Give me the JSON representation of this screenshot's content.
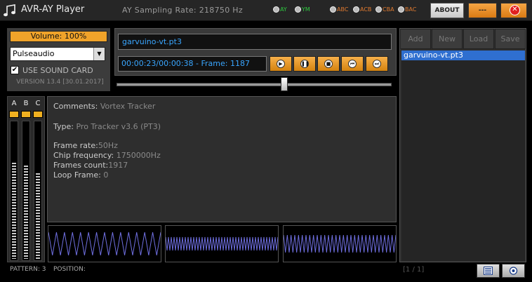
{
  "window": {
    "title": "AVR-AY Player",
    "sampling_rate": "AY Sampling Rate: 218750 Hz"
  },
  "modes": {
    "chip": [
      {
        "label": "AY",
        "color": "#2ecc40"
      },
      {
        "label": "YM",
        "color": "#2ecc40"
      }
    ],
    "stereo": [
      {
        "label": "ABC",
        "color": "#e07a30"
      },
      {
        "label": "ACB",
        "color": "#e07a30"
      },
      {
        "label": "CBA",
        "color": "#e07a30"
      },
      {
        "label": "BAC",
        "color": "#e07a30"
      }
    ]
  },
  "titlebar_buttons": {
    "about": "ABOUT",
    "minimize": "---",
    "close_icon": "close-icon"
  },
  "audio": {
    "volume": "Volume: 100%",
    "device": "Pulseaudio",
    "use_sound_card_label": "USE SOUND CARD",
    "use_sound_card_checked": "✔",
    "version": "VERSION 13.4 [30.01.2017]"
  },
  "player": {
    "filename": "garvuino-vt.pt3",
    "time_display": "00:00:23/00:00:38 - Frame: 1187",
    "seek_fraction": 0.61
  },
  "controls": {
    "play_icon": "play-icon",
    "pause_icon": "pause-icon",
    "stop_icon": "stop-icon",
    "prev_icon": "previous-icon",
    "next_icon": "next-icon"
  },
  "channels": {
    "labels": [
      "A",
      "B",
      "C"
    ],
    "levels": [
      0.7,
      0.68,
      0.62
    ],
    "accent": "#f0b020"
  },
  "info": {
    "comments_label": "Comments:",
    "comments_value": " Vortex Tracker",
    "type_label": "Type:",
    "type_value": " Pro Tracker v3.6 (PT3)",
    "frame_rate_label": "Frame rate:",
    "frame_rate_value": "50Hz",
    "chip_freq_label": "Chip frequency:",
    "chip_freq_value": " 1750000Hz",
    "frames_count_label": "Frames count:",
    "frames_count_value": "1917",
    "loop_frame_label": "Loop Frame:",
    "loop_frame_value": " 0"
  },
  "status": {
    "pattern": "PATTERN: 3",
    "position": "POSITION:"
  },
  "playlist": {
    "buttons": {
      "add": "Add",
      "new": "New",
      "load": "Load",
      "save": "Save"
    },
    "items": [
      "garvuino-vt.pt3"
    ],
    "page": "[1 / 1]",
    "selection_color": "#2f6fd0"
  },
  "bottom_buttons": {
    "playlist_icon": "playlist-icon",
    "settings_icon": "settings-icon"
  }
}
